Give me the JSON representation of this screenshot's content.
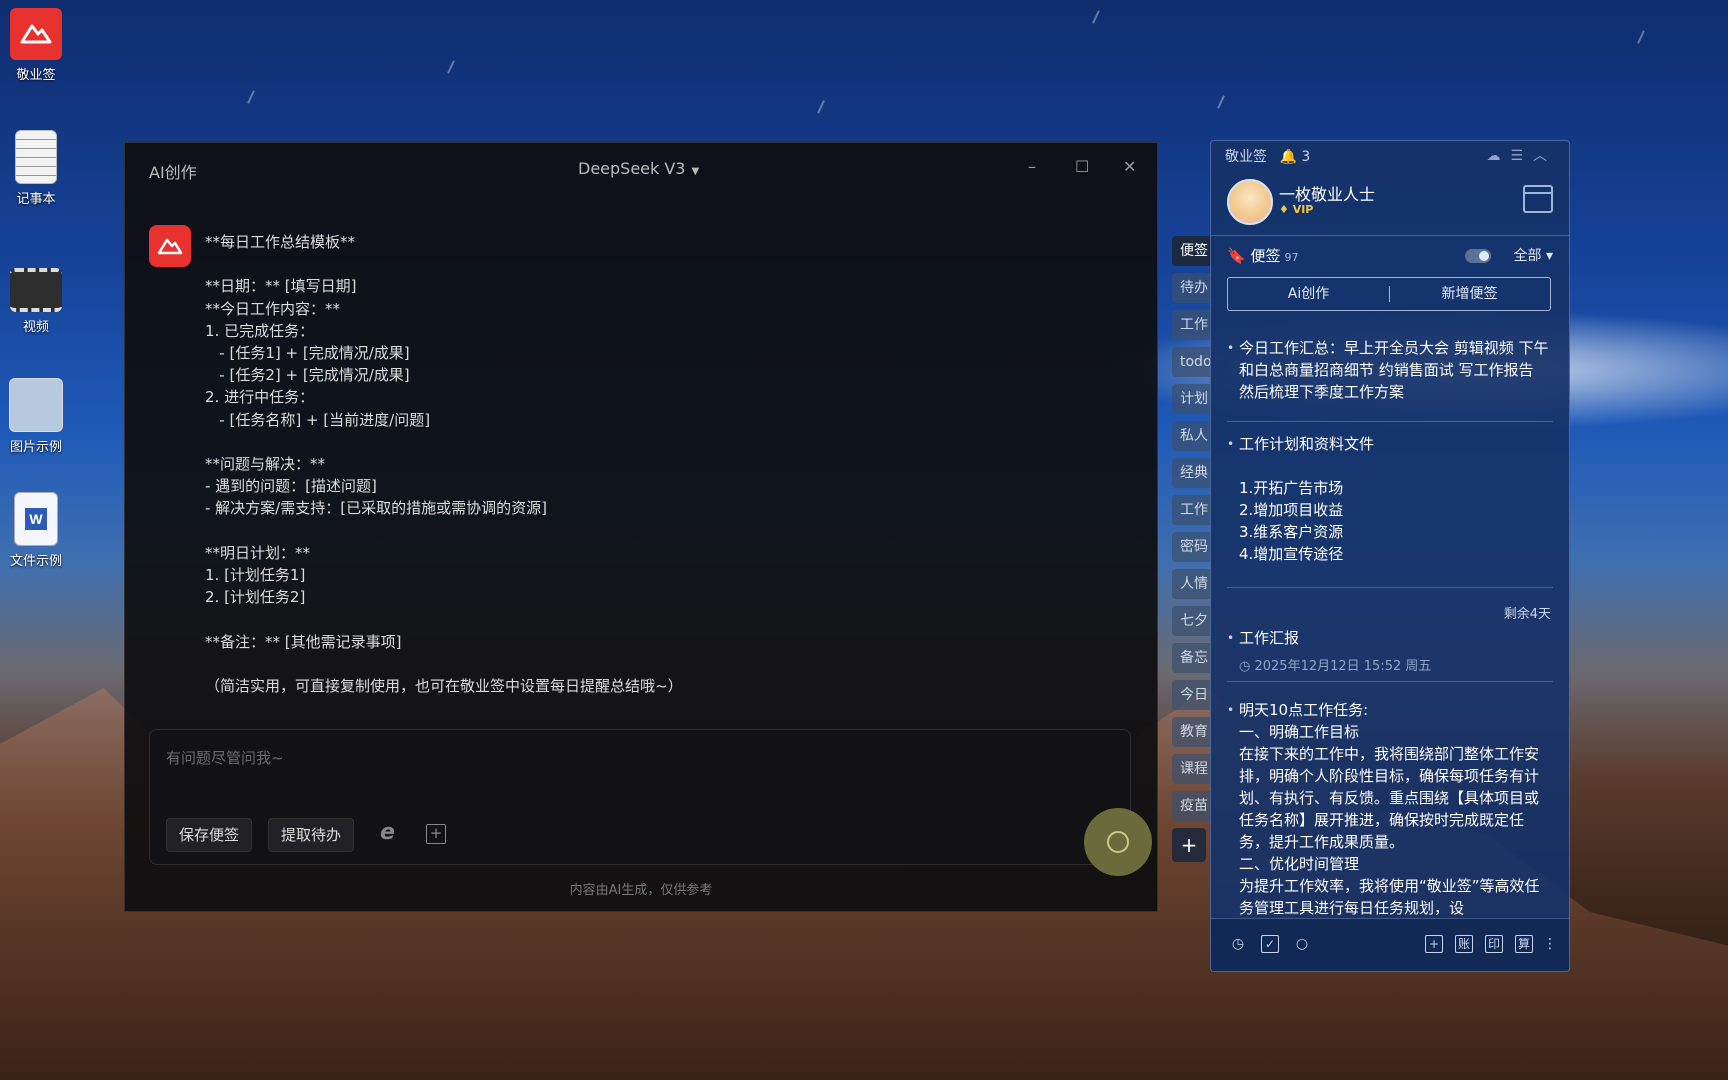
{
  "desktop": {
    "icons": [
      {
        "label": "敬业签",
        "icon": "app-logo-icon"
      },
      {
        "label": "记事本",
        "icon": "text-file-icon"
      },
      {
        "label": "视频",
        "icon": "video-file-icon"
      },
      {
        "label": "图片示例",
        "icon": "image-file-icon"
      },
      {
        "label": "文件示例",
        "icon": "word-file-icon"
      }
    ]
  },
  "ai_window": {
    "title": "AI创作",
    "model": "DeepSeek V3",
    "controls": {
      "minimize": "–",
      "maximize": "☐",
      "close": "✕"
    },
    "response": "**每日工作总结模板**\n\n**日期：** [填写日期]\n**今日工作内容：**\n1. 已完成任务：\n   - [任务1] + [完成情况/成果]\n   - [任务2] + [完成情况/成果]\n2. 进行中任务：\n   - [任务名称] + [当前进度/问题]\n\n**问题与解决：**\n- 遇到的问题：[描述问题]\n- 解决方案/需支持：[已采取的措施或需协调的资源]\n\n**明日计划：**\n1. [计划任务1]\n2. [计划任务2]\n\n**备注：** [其他需记录事项]\n\n（简洁实用，可直接复制使用，也可在敬业签中设置每日提醒总结哦~）",
    "input_placeholder": "有问题尽管问我~",
    "save_note_label": "保存便签",
    "extract_todo_label": "提取待办",
    "footer": "内容由AI生成，仅供参考"
  },
  "side_tabs": [
    "便签",
    "待办",
    "工作",
    "todo",
    "计划",
    "私人",
    "经典",
    "工作",
    "密码",
    "人情",
    "七夕",
    "备忘",
    "今日",
    "教育",
    "课程",
    "疫苗"
  ],
  "notes_panel": {
    "app_name": "敬业签",
    "notification_count": "3",
    "user": {
      "name": "一枚敬业人士",
      "badge": "VIP"
    },
    "section_label": "便签",
    "note_count": "97",
    "filter": "全部",
    "ai_button": "Ai创作",
    "new_note_button": "新增便签",
    "notes": [
      {
        "text": "今日工作汇总：早上开全员大会 剪辑视频 下午和白总商量招商细节 约销售面试 写工作报告 然后梳理下季度工作方案"
      },
      {
        "text": "工作计划和资料文件\n\n1.开拓广告市场\n2.增加项目收益\n3.维系客户资源\n4.增加宣传途径"
      },
      {
        "text": "工作汇报",
        "remaining": "剩余4天",
        "time": "2025年12月12日 15:52 周五"
      },
      {
        "text": "明天10点工作任务:\n一、明确工作目标\n在接下来的工作中，我将围绕部门整体工作安排，明确个人阶段性目标，确保每项任务有计划、有执行、有反馈。重点围绕【具体项目或任务名称】展开推进，确保按时完成既定任务，提升工作成果质量。\n二、优化时间管理\n为提升工作效率，我将使用“敬业签”等高效任务管理工具进行每日任务规划，设"
      }
    ],
    "bottom_icons": {
      "ledger": "账",
      "print": "印",
      "calc": "算"
    }
  }
}
